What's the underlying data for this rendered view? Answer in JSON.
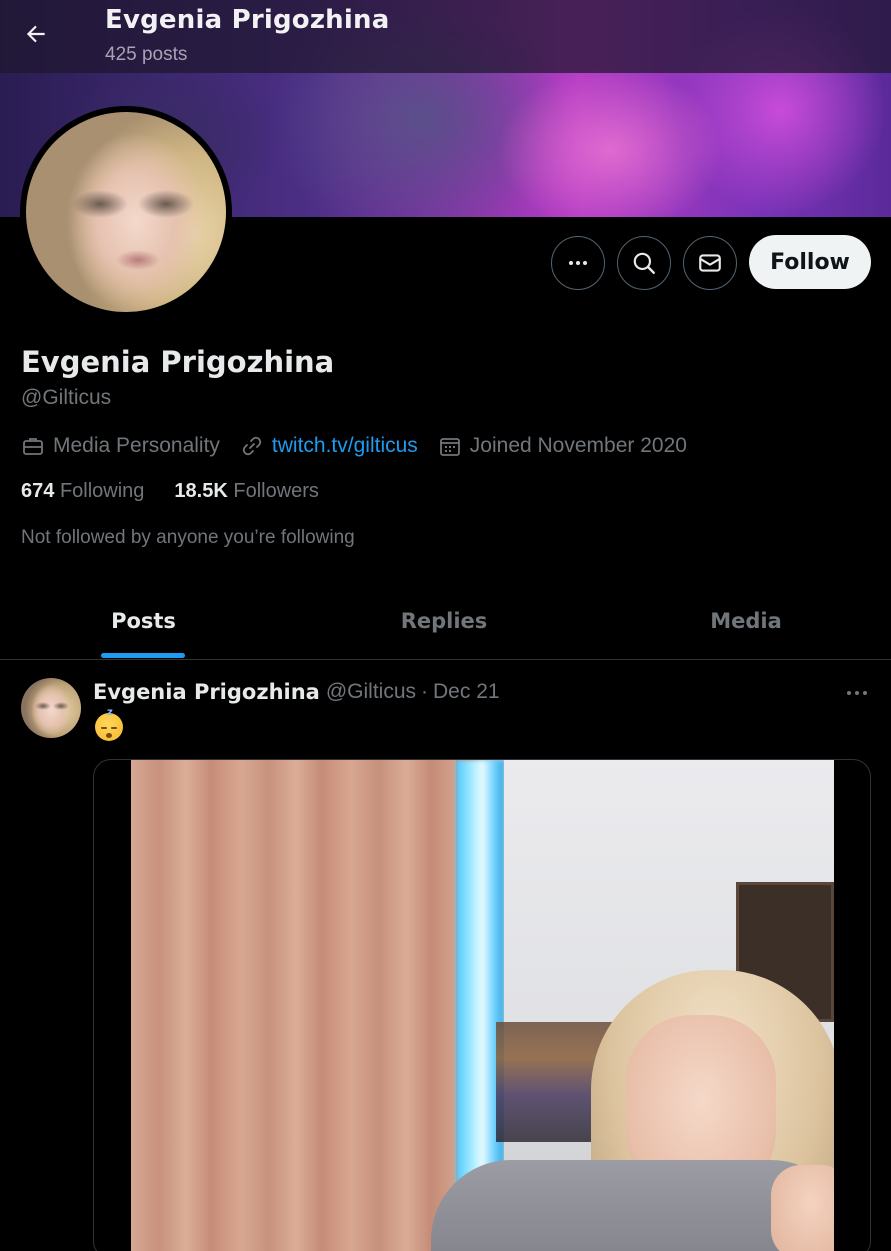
{
  "header": {
    "title": "Evgenia Prigozhina",
    "post_count": "425 posts"
  },
  "profile": {
    "display_name": "Evgenia Prigozhina",
    "handle": "@Gilticus",
    "category": "Media Personality",
    "website": "twitch.tv/gilticus",
    "joined": "Joined November 2020",
    "following_count": "674",
    "following_label": "Following",
    "followers_count": "18.5K",
    "followers_label": "Followers",
    "mutuals_note": "Not followed by anyone you’re following"
  },
  "actions": {
    "follow_label": "Follow"
  },
  "tabs": [
    {
      "label": "Posts",
      "active": true
    },
    {
      "label": "Replies",
      "active": false
    },
    {
      "label": "Media",
      "active": false
    }
  ],
  "post": {
    "author_name": "Evgenia Prigozhina",
    "author_handle": "@Gilticus",
    "separator": "·",
    "date": "Dec 21",
    "text_emoji": "sleeping-face-emoji"
  },
  "icons": {
    "back": "arrow-left-icon",
    "more": "ellipsis-icon",
    "search": "search-icon",
    "message": "envelope-icon",
    "category": "briefcase-icon",
    "website": "link-icon",
    "joined": "calendar-icon"
  },
  "colors": {
    "accent": "#1d9bf0",
    "background": "#000000",
    "text_primary": "#e7e9ea",
    "text_secondary": "#71767b",
    "follow_button_bg": "#eff3f4"
  }
}
